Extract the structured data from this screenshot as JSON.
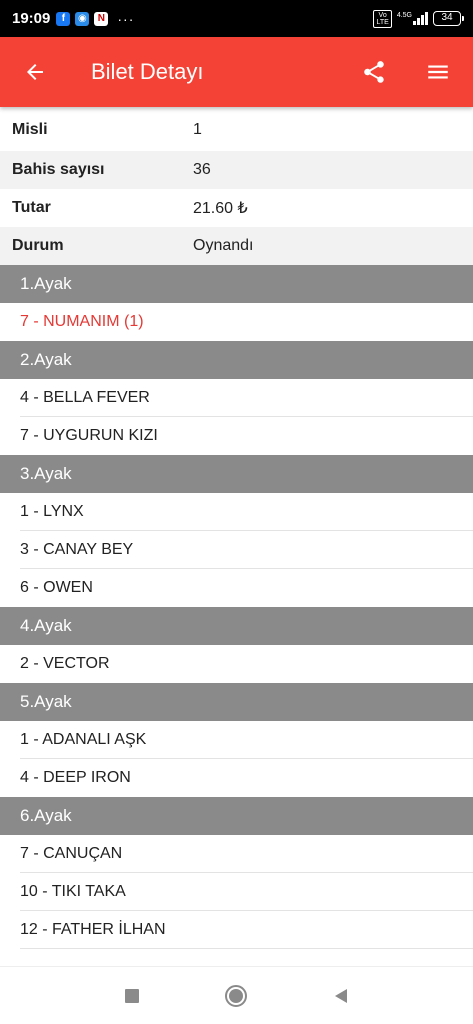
{
  "status_bar": {
    "time": "19:09",
    "dots": "···",
    "volte": "Vo\nLTE",
    "network": "4.5G",
    "battery": "34"
  },
  "app_bar": {
    "title": "Bilet Detayı",
    "color": "#f44336",
    "icons": [
      "back-arrow-icon",
      "share-icon",
      "menu-icon"
    ]
  },
  "details": [
    {
      "label": "Misli",
      "value": "1"
    },
    {
      "label": "Bahis sayısı",
      "value": "36"
    },
    {
      "label": "Tutar",
      "value": "21.60 ₺"
    },
    {
      "label": "Durum",
      "value": "Oynandı"
    }
  ],
  "legs": [
    {
      "title": "1.Ayak",
      "runners": [
        "7 - NUMANIM (1)"
      ],
      "highlight_color": "#e53935"
    },
    {
      "title": "2.Ayak",
      "runners": [
        "4 - BELLA FEVER",
        "7 - UYGURUN KIZI"
      ]
    },
    {
      "title": "3.Ayak",
      "runners": [
        "1 - LYNX",
        "3 - CANAY BEY",
        "6 - OWEN"
      ]
    },
    {
      "title": "4.Ayak",
      "runners": [
        "2 - VECTOR"
      ]
    },
    {
      "title": "5.Ayak",
      "runners": [
        "1 - ADANALI AŞK",
        "4 - DEEP IRON"
      ]
    },
    {
      "title": "6.Ayak",
      "runners": [
        "7 - CANUÇAN",
        "10 - TIKI TAKA",
        "12 - FATHER İLHAN"
      ]
    }
  ],
  "nav_bar": {
    "icons": [
      "recents-square-icon",
      "home-circle-icon",
      "back-triangle-icon"
    ]
  }
}
